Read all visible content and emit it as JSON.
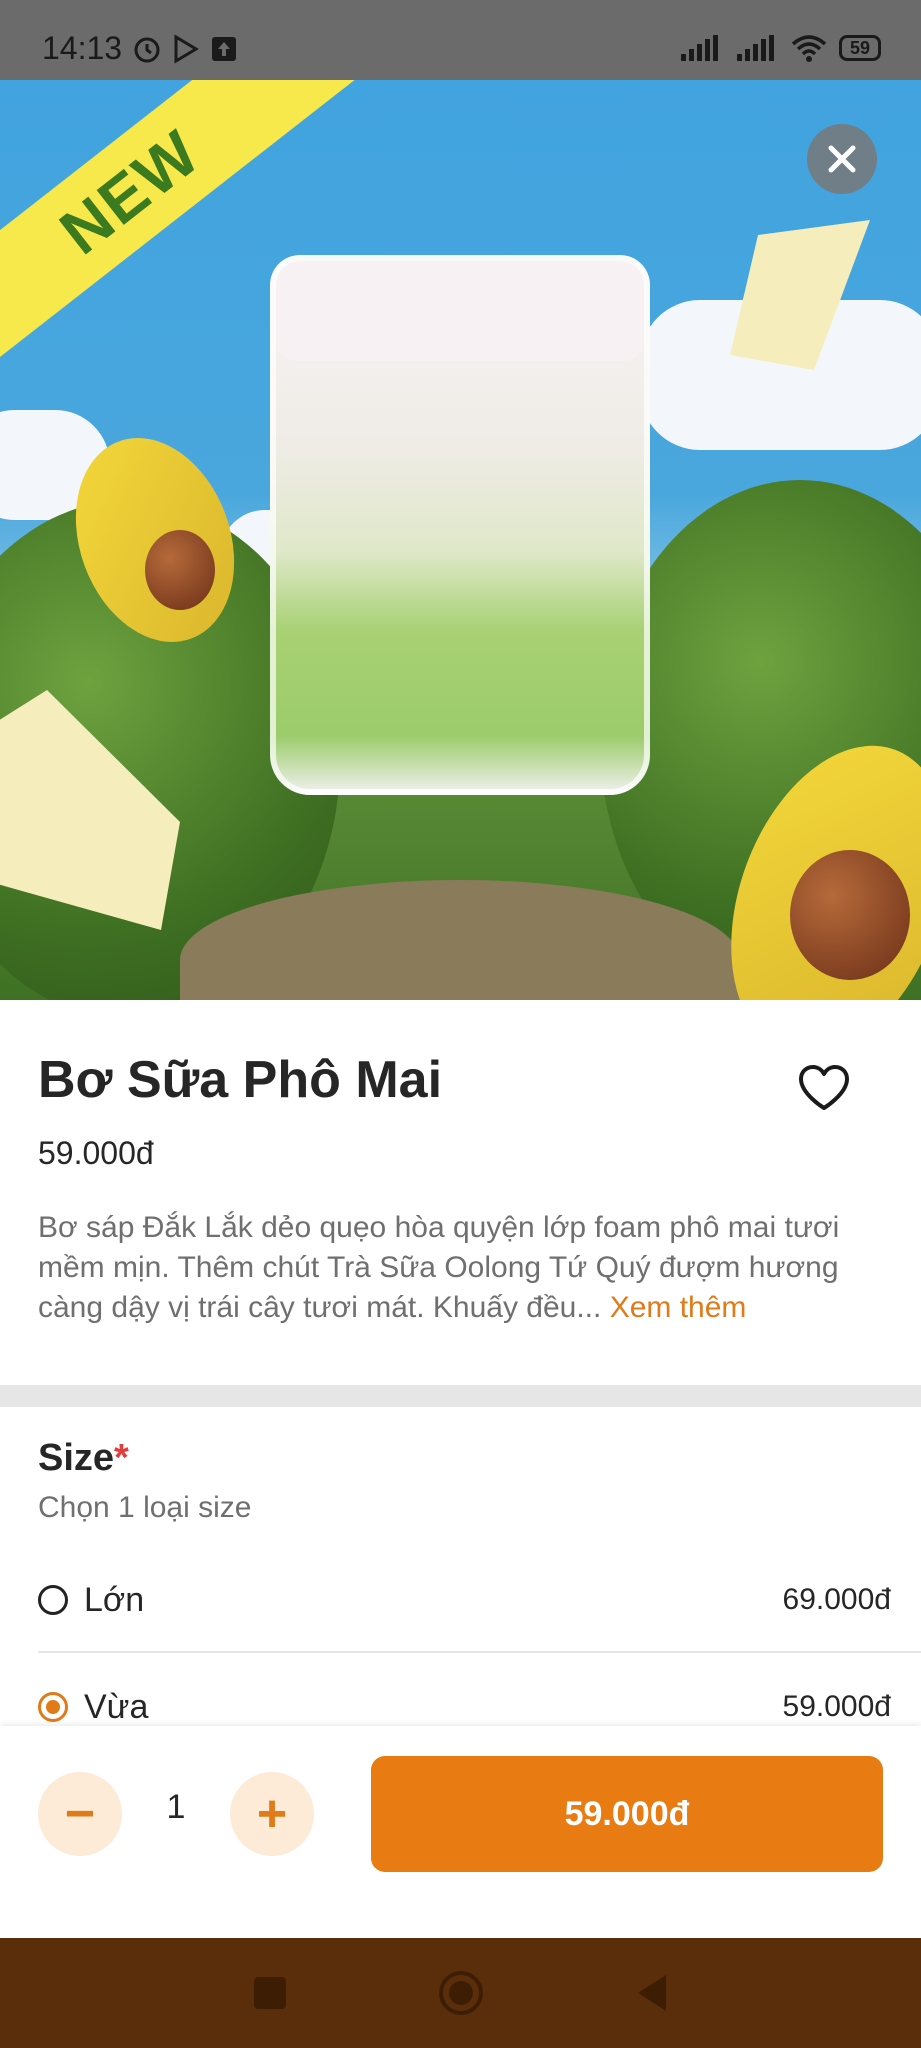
{
  "status_bar": {
    "time": "14:13",
    "icons": [
      "alarm-icon",
      "play-store-icon",
      "upload-icon",
      "signal-icon",
      "signal-icon",
      "wifi-icon"
    ],
    "battery": "59"
  },
  "hero": {
    "badge": "NEW",
    "close_icon": "close-icon"
  },
  "product": {
    "name": "Bơ Sữa Phô Mai",
    "price": "59.000đ",
    "description": "Bơ sáp Đắk Lắk dẻo quẹo hòa quyện lớp foam phô mai tươi mềm mịn. Thêm chút Trà Sữa Oolong Tứ Quý đượm hương càng dậy vị trái cây tươi mát. Khuấy đều...",
    "see_more": "Xem thêm",
    "favorite_icon": "heart-icon"
  },
  "size": {
    "title": "Size",
    "required_mark": "*",
    "subtitle": "Chọn 1 loại size",
    "options": [
      {
        "label": "Lớn",
        "price": "69.000đ",
        "selected": false
      },
      {
        "label": "Vừa",
        "price": "59.000đ",
        "selected": true
      }
    ]
  },
  "bottom": {
    "minus": "−",
    "quantity": "1",
    "plus": "+",
    "add_button_label": "59.000đ"
  },
  "colors": {
    "accent": "#e87b12",
    "accent_light": "#fdebd7",
    "nav_bar": "#5a2e0a"
  }
}
